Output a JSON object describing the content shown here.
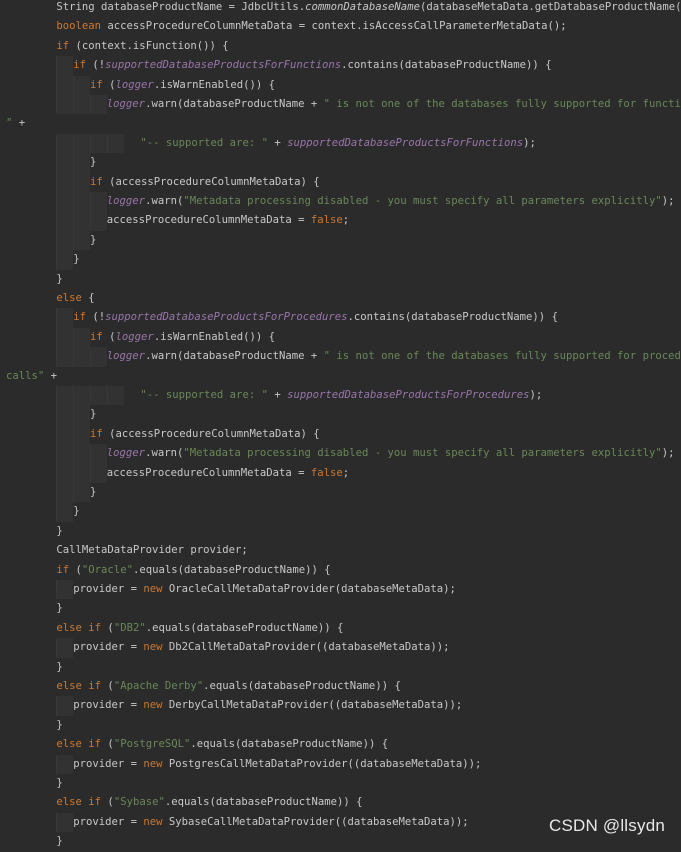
{
  "watermark": "CSDN @llsydn",
  "colors": {
    "background": "#2b2b2b",
    "keyword": "#cc7832",
    "string": "#6a8759",
    "field": "#9876aa",
    "plain": "#c8c8c8"
  },
  "code_lines": [
    {
      "indent": 3,
      "tokens": [
        [
          "t",
          "String databaseProductName = JdbcUtils."
        ],
        [
          "s",
          "commonDatabaseName"
        ],
        [
          "t",
          "(databaseMetaData.getDatabaseProductName());"
        ]
      ]
    },
    {
      "indent": 3,
      "tokens": [
        [
          "k",
          "boolean "
        ],
        [
          "t",
          "accessProcedureColumnMetaData = context.isAccessCallParameterMetaData();"
        ]
      ]
    },
    {
      "indent": 3,
      "tokens": [
        [
          "k",
          "if "
        ],
        [
          "t",
          "(context.isFunction()) {"
        ]
      ]
    },
    {
      "indent": 4,
      "tokens": [
        [
          "k",
          "if "
        ],
        [
          "t",
          "(!"
        ],
        [
          "f",
          "supportedDatabaseProductsForFunctions"
        ],
        [
          "t",
          ".contains(databaseProductName)) {"
        ]
      ]
    },
    {
      "indent": 5,
      "tokens": [
        [
          "k",
          "if "
        ],
        [
          "t",
          "("
        ],
        [
          "f",
          "logger"
        ],
        [
          "t",
          ".isWarnEnabled()) {"
        ]
      ]
    },
    {
      "indent": 6,
      "tokens": [
        [
          "f",
          "logger"
        ],
        [
          "t",
          ".warn(databaseProductName + "
        ],
        [
          "r",
          "\" is not one of the databases fully supported for function calls"
        ]
      ]
    },
    {
      "indent": 0,
      "tokens": [
        [
          "r",
          "\" "
        ],
        [
          "t",
          "+"
        ]
      ]
    },
    {
      "indent": 8,
      "tokens": [
        [
          "r",
          "\"-- supported are: \" "
        ],
        [
          "t",
          "+ "
        ],
        [
          "f",
          "supportedDatabaseProductsForFunctions"
        ],
        [
          "t",
          ");"
        ]
      ]
    },
    {
      "indent": 5,
      "tokens": [
        [
          "t",
          "}"
        ]
      ]
    },
    {
      "indent": 5,
      "tokens": [
        [
          "k",
          "if "
        ],
        [
          "t",
          "(accessProcedureColumnMetaData) {"
        ]
      ]
    },
    {
      "indent": 6,
      "tokens": [
        [
          "f",
          "logger"
        ],
        [
          "t",
          ".warn("
        ],
        [
          "r",
          "\"Metadata processing disabled - you must specify all parameters explicitly\""
        ],
        [
          "t",
          ");"
        ]
      ]
    },
    {
      "indent": 6,
      "tokens": [
        [
          "t",
          "accessProcedureColumnMetaData = "
        ],
        [
          "k",
          "false"
        ],
        [
          "t",
          ";"
        ]
      ]
    },
    {
      "indent": 5,
      "tokens": [
        [
          "t",
          "}"
        ]
      ]
    },
    {
      "indent": 4,
      "tokens": [
        [
          "t",
          "}"
        ]
      ]
    },
    {
      "indent": 3,
      "tokens": [
        [
          "t",
          "}"
        ]
      ]
    },
    {
      "indent": 3,
      "tokens": [
        [
          "k",
          "else "
        ],
        [
          "t",
          "{"
        ]
      ]
    },
    {
      "indent": 4,
      "tokens": [
        [
          "k",
          "if "
        ],
        [
          "t",
          "(!"
        ],
        [
          "f",
          "supportedDatabaseProductsForProcedures"
        ],
        [
          "t",
          ".contains(databaseProductName)) {"
        ]
      ]
    },
    {
      "indent": 5,
      "tokens": [
        [
          "k",
          "if "
        ],
        [
          "t",
          "("
        ],
        [
          "f",
          "logger"
        ],
        [
          "t",
          ".isWarnEnabled()) {"
        ]
      ]
    },
    {
      "indent": 6,
      "tokens": [
        [
          "f",
          "logger"
        ],
        [
          "t",
          ".warn(databaseProductName + "
        ],
        [
          "r",
          "\" is not one of the databases fully supported for procedure"
        ]
      ]
    },
    {
      "indent": 0,
      "tokens": [
        [
          "r",
          "calls\" "
        ],
        [
          "t",
          "+"
        ]
      ]
    },
    {
      "indent": 8,
      "tokens": [
        [
          "r",
          "\"-- supported are: \" "
        ],
        [
          "t",
          "+ "
        ],
        [
          "f",
          "supportedDatabaseProductsForProcedures"
        ],
        [
          "t",
          ");"
        ]
      ]
    },
    {
      "indent": 5,
      "tokens": [
        [
          "t",
          "}"
        ]
      ]
    },
    {
      "indent": 5,
      "tokens": [
        [
          "k",
          "if "
        ],
        [
          "t",
          "(accessProcedureColumnMetaData) {"
        ]
      ]
    },
    {
      "indent": 6,
      "tokens": [
        [
          "f",
          "logger"
        ],
        [
          "t",
          ".warn("
        ],
        [
          "r",
          "\"Metadata processing disabled - you must specify all parameters explicitly\""
        ],
        [
          "t",
          ");"
        ]
      ]
    },
    {
      "indent": 6,
      "tokens": [
        [
          "t",
          "accessProcedureColumnMetaData = "
        ],
        [
          "k",
          "false"
        ],
        [
          "t",
          ";"
        ]
      ]
    },
    {
      "indent": 5,
      "tokens": [
        [
          "t",
          "}"
        ]
      ]
    },
    {
      "indent": 4,
      "tokens": [
        [
          "t",
          "}"
        ]
      ]
    },
    {
      "indent": 3,
      "tokens": [
        [
          "t",
          "}"
        ]
      ]
    },
    {
      "indent": 3,
      "tokens": [
        [
          "t",
          "CallMetaDataProvider provider;"
        ]
      ]
    },
    {
      "indent": 3,
      "tokens": [
        [
          "k",
          "if "
        ],
        [
          "t",
          "("
        ],
        [
          "r",
          "\"Oracle\""
        ],
        [
          "t",
          ".equals(databaseProductName)) {"
        ]
      ]
    },
    {
      "indent": 4,
      "tokens": [
        [
          "t",
          "provider = "
        ],
        [
          "k",
          "new "
        ],
        [
          "t",
          "OracleCallMetaDataProvider(databaseMetaData);"
        ]
      ]
    },
    {
      "indent": 3,
      "tokens": [
        [
          "t",
          "}"
        ]
      ]
    },
    {
      "indent": 3,
      "tokens": [
        [
          "k",
          "else if "
        ],
        [
          "t",
          "("
        ],
        [
          "r",
          "\"DB2\""
        ],
        [
          "t",
          ".equals(databaseProductName)) {"
        ]
      ]
    },
    {
      "indent": 4,
      "tokens": [
        [
          "t",
          "provider = "
        ],
        [
          "k",
          "new "
        ],
        [
          "t",
          "Db2CallMetaDataProvider((databaseMetaData));"
        ]
      ]
    },
    {
      "indent": 3,
      "tokens": [
        [
          "t",
          "}"
        ]
      ]
    },
    {
      "indent": 3,
      "tokens": [
        [
          "k",
          "else if "
        ],
        [
          "t",
          "("
        ],
        [
          "r",
          "\"Apache Derby\""
        ],
        [
          "t",
          ".equals(databaseProductName)) {"
        ]
      ]
    },
    {
      "indent": 4,
      "tokens": [
        [
          "t",
          "provider = "
        ],
        [
          "k",
          "new "
        ],
        [
          "t",
          "DerbyCallMetaDataProvider((databaseMetaData));"
        ]
      ]
    },
    {
      "indent": 3,
      "tokens": [
        [
          "t",
          "}"
        ]
      ]
    },
    {
      "indent": 3,
      "tokens": [
        [
          "k",
          "else if "
        ],
        [
          "t",
          "("
        ],
        [
          "r",
          "\"PostgreSQL\""
        ],
        [
          "t",
          ".equals(databaseProductName)) {"
        ]
      ]
    },
    {
      "indent": 4,
      "tokens": [
        [
          "t",
          "provider = "
        ],
        [
          "k",
          "new "
        ],
        [
          "t",
          "PostgresCallMetaDataProvider((databaseMetaData));"
        ]
      ]
    },
    {
      "indent": 3,
      "tokens": [
        [
          "t",
          "}"
        ]
      ]
    },
    {
      "indent": 3,
      "tokens": [
        [
          "k",
          "else if "
        ],
        [
          "t",
          "("
        ],
        [
          "r",
          "\"Sybase\""
        ],
        [
          "t",
          ".equals(databaseProductName)) {"
        ]
      ]
    },
    {
      "indent": 4,
      "tokens": [
        [
          "t",
          "provider = "
        ],
        [
          "k",
          "new "
        ],
        [
          "t",
          "SybaseCallMetaDataProvider((databaseMetaData));"
        ]
      ]
    },
    {
      "indent": 3,
      "tokens": [
        [
          "t",
          "}"
        ]
      ]
    }
  ]
}
